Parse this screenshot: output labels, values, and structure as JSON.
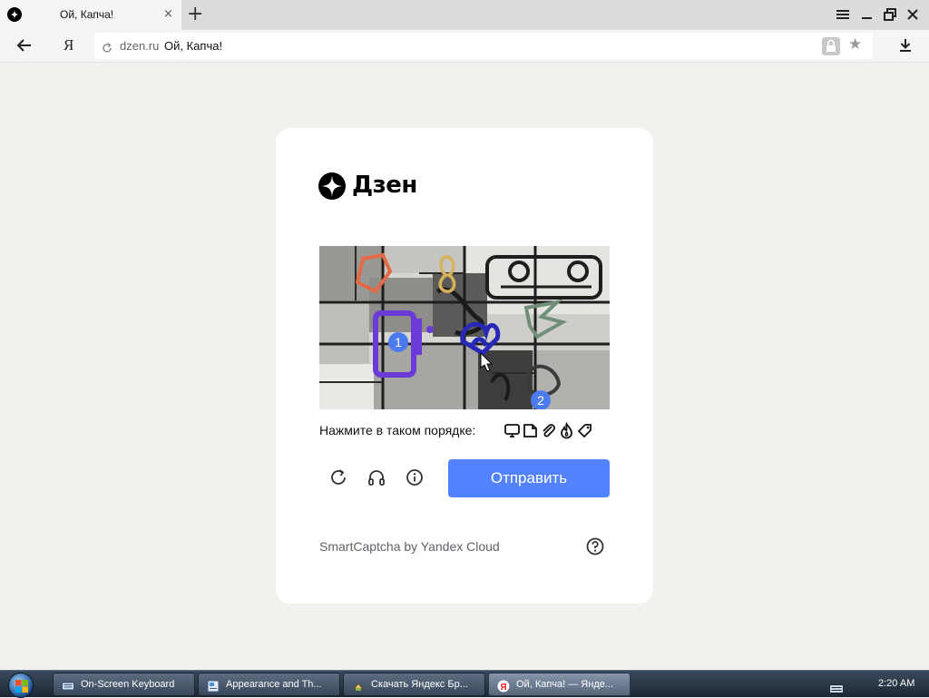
{
  "browser": {
    "tab": {
      "title": "Ой, Капча!",
      "close": "×"
    },
    "new_tab": "+",
    "address": {
      "logo": "Я",
      "domain": "dzen.ru",
      "page_title": "Ой, Капча!"
    }
  },
  "card": {
    "brand": "Дзен",
    "captcha": {
      "markers": [
        "1",
        "2"
      ],
      "instruction": "Нажмите в таком порядке:",
      "order_icons": [
        "monitor-icon",
        "sticker-icon",
        "paperclip-icon",
        "fire-icon",
        "tag-icon"
      ]
    },
    "controls": {
      "refresh": "refresh-icon",
      "audio": "headphones-icon",
      "info": "info-icon",
      "submit_label": "Отправить"
    },
    "footer": {
      "text": "SmartCaptcha by Yandex Cloud",
      "help": "help-icon"
    }
  },
  "taskbar": {
    "items": [
      {
        "label": "On-Screen Keyboard",
        "active": false
      },
      {
        "label": "Appearance and Th...",
        "active": false
      },
      {
        "label": "Скачать Яндекс Бр...",
        "active": false
      },
      {
        "label": "Ой, Капча! — Янде...",
        "active": true
      }
    ],
    "clock": "2:20 AM"
  },
  "colors": {
    "accent": "#5282ff",
    "page_bg": "#f2f1ee",
    "card_bg": "#ffffff"
  }
}
